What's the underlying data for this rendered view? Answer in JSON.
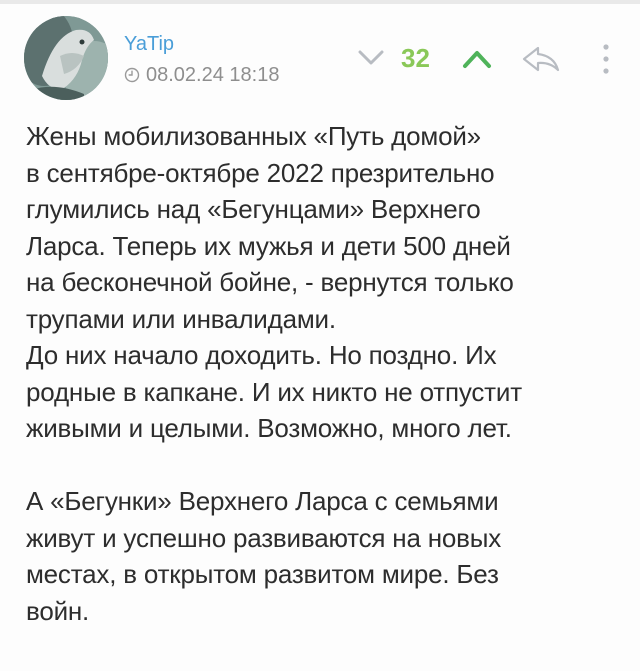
{
  "post": {
    "author": "YaTip",
    "date": "08.02.24 18:18",
    "score": "32",
    "paragraphs": [
      "Жены мобилизованных «Путь домой»\nв сентябре-октябре 2022 презрительно\nглумились над «Бегунцами» Верхнего\nЛарса. Теперь их мужья и дети 500 дней\nна бесконечной бойне, - вернутся только\nтрупами или инвалидами.\nДо них начало доходить. Но поздно. Их\nродные в капкане. И их никто не отпустит\nживыми и целыми. Возможно, много лет.",
      "А «Бегунки» Верхнего Ларса с семьями\nживут и успешно развиваются на новых\nместах, в открытом развитом мире. Без\nвойн."
    ]
  },
  "icons": {
    "clock": "clock-icon",
    "vote_down": "chevron-down-icon",
    "vote_up": "chevron-up-icon",
    "share": "share-icon",
    "more": "more-vertical-icon"
  },
  "colors": {
    "author": "#4a9ed8",
    "score": "#8ac858",
    "vote_up": "#4fb35a",
    "muted": "#8e8e8e",
    "text": "#2d2d2d"
  }
}
